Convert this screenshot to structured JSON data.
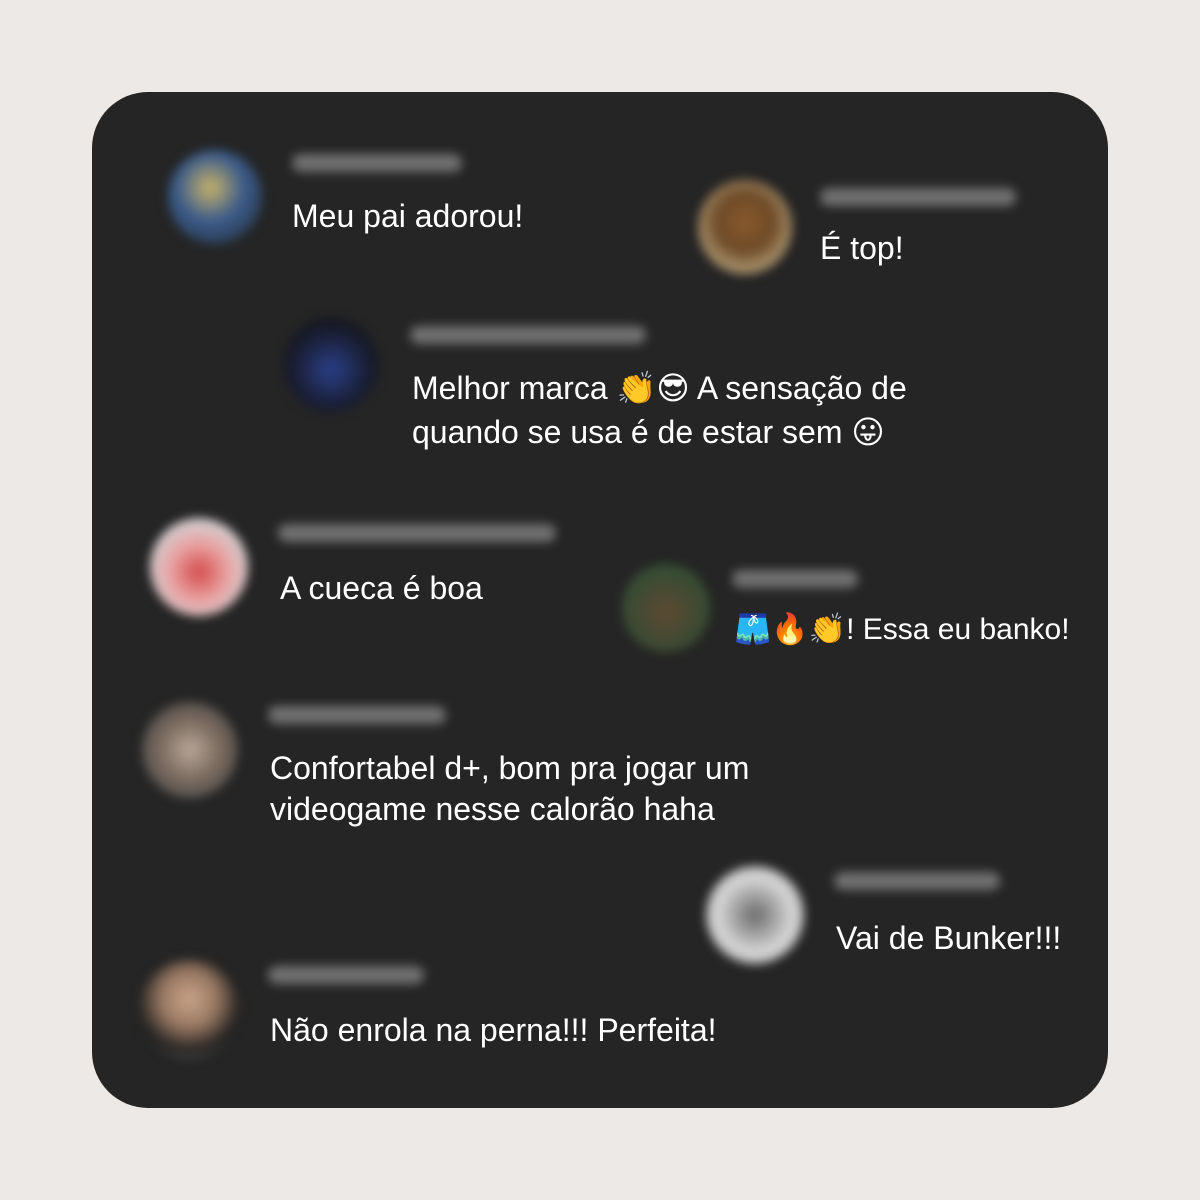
{
  "colors": {
    "page_background": "#ede9e6",
    "card_background": "#252525",
    "text": "#ffffff"
  },
  "comments": [
    {
      "id": "c1",
      "text": "Meu pai adorou!"
    },
    {
      "id": "c2",
      "text": "É top!"
    },
    {
      "id": "c3",
      "text_before": "Melhor marca ",
      "emoji": "👏😎",
      "text_after": " A sensação de quando se usa é de estar sem ",
      "emoji_end": "😛"
    },
    {
      "id": "c4",
      "text": "A cueca é boa"
    },
    {
      "id": "c5",
      "emoji": "🩳🔥👏",
      "text": "! Essa eu banko!"
    },
    {
      "id": "c6",
      "text": "Confortabel d+, bom pra jogar um videogame nesse calorão haha"
    },
    {
      "id": "c7",
      "text": "Vai de Bunker!!!"
    },
    {
      "id": "c8",
      "text": "Não enrola na perna!!! Perfeita!"
    }
  ]
}
